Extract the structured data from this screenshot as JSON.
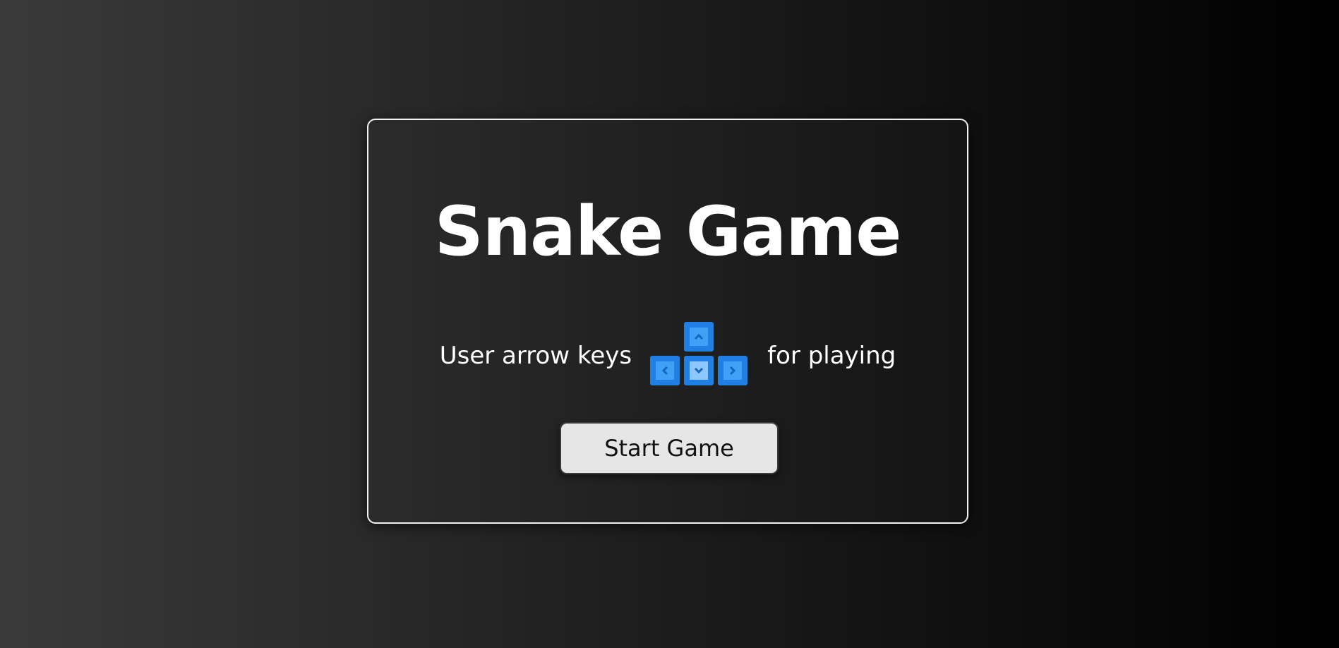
{
  "game": {
    "title": "Snake Game",
    "instruction_before": "User arrow keys",
    "instruction_after": "for playing",
    "start_label": "Start Game"
  },
  "icons": {
    "keys": [
      "arrow-up-key-icon",
      "arrow-left-key-icon",
      "arrow-down-key-icon",
      "arrow-right-key-icon"
    ]
  },
  "colors": {
    "key_blue": "#1f7fe3",
    "key_face": "#3fa0f5",
    "card_border": "#f2f2f2",
    "button_bg": "#e6e6e6"
  }
}
